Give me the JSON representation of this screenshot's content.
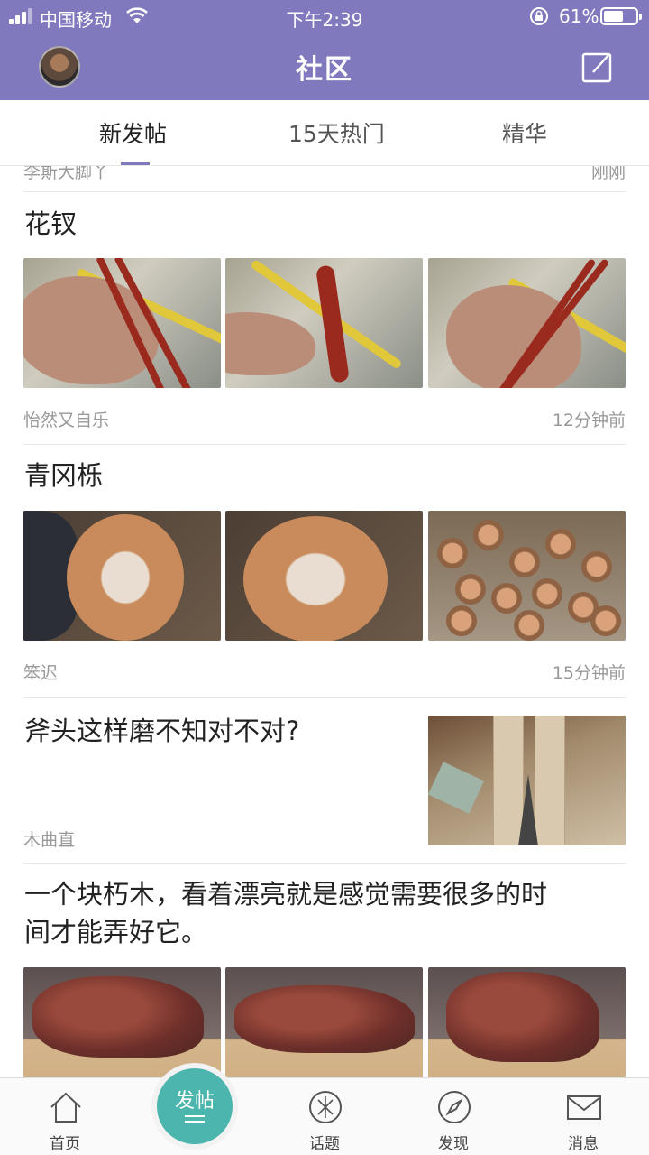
{
  "status_bar": {
    "carrier": "中国移动",
    "time": "下午2:39",
    "battery_percent": "61%",
    "battery_level": 0.61
  },
  "header": {
    "title": "社区",
    "avatar_icon": "user-avatar",
    "edit_icon": "compose-icon"
  },
  "tabs": [
    {
      "label": "新发帖",
      "active": true
    },
    {
      "label": "15天热门",
      "active": false
    },
    {
      "label": "精华",
      "active": false
    }
  ],
  "previous_post": {
    "author": "李斯大脚丫",
    "time": "刚刚"
  },
  "posts": [
    {
      "title": "花钗",
      "author": "怡然又自乐",
      "time": "12分钟前",
      "images": [
        "hairpin-photo-1",
        "hairpin-photo-2",
        "hairpin-photo-3"
      ]
    },
    {
      "title": "青冈栎",
      "author": "笨迟",
      "time": "15分钟前",
      "images": [
        "log-photo-1",
        "log-photo-2",
        "log-pile-photo"
      ]
    },
    {
      "title": "斧头这样磨不知对不对?",
      "author": "木曲直",
      "images": [
        "axe-sharpening-photo"
      ]
    },
    {
      "title_line1": "一个块朽木，看着漂亮就是感觉需要很多的时",
      "title_line2": "间才能弄好它。",
      "images": [
        "rotten-wood-photo-1",
        "rotten-wood-photo-2",
        "rotten-wood-photo-3"
      ]
    }
  ],
  "bottom_nav": {
    "home": "首页",
    "post_button": "发帖",
    "topics": "话题",
    "discover": "发现",
    "messages": "消息"
  },
  "colors": {
    "header": "#8079bd",
    "accent": "#8079bd",
    "fab": "#4cb5ad"
  }
}
